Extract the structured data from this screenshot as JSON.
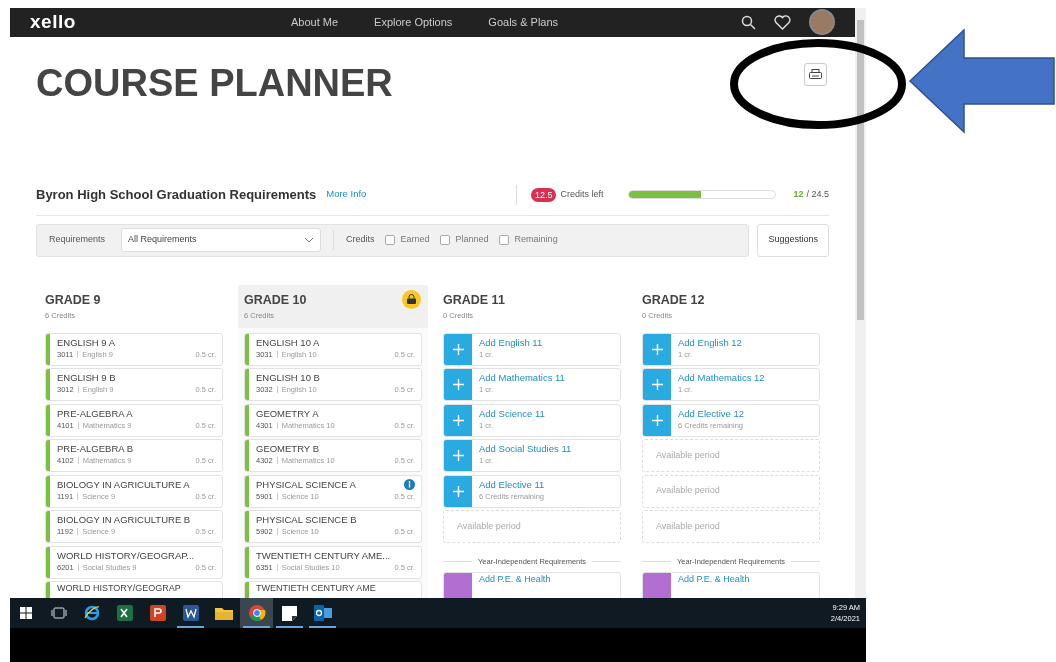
{
  "nav": {
    "logo": "xello",
    "links": [
      "About Me",
      "Explore Options",
      "Goals & Plans"
    ]
  },
  "page_title": "COURSE PLANNER",
  "requirements": {
    "title": "Byron High School Graduation Requirements",
    "more_info": "More Info",
    "credits_left": "12.5",
    "credits_left_label": "Credits left",
    "level": 0.49,
    "earned": "12",
    "total": "/ 24.5"
  },
  "filters": {
    "requirements_label": "Requirements",
    "requirements_value": "All Requirements",
    "credits_label": "Credits",
    "checkboxes": [
      {
        "label": "Earned",
        "checked": false
      },
      {
        "label": "Planned",
        "checked": false
      },
      {
        "label": "Remaining",
        "checked": false
      }
    ],
    "suggestions": "Suggestions"
  },
  "grades": [
    {
      "title": "GRADE 9",
      "credits": "6 Credits",
      "current": false,
      "locked": false,
      "items": [
        {
          "kind": "course",
          "name": "ENGLISH 9 A",
          "code": "3011",
          "subject": "English 9",
          "credits": "0.5 cr.",
          "info": false
        },
        {
          "kind": "course",
          "name": "ENGLISH 9 B",
          "code": "3012",
          "subject": "English 9",
          "credits": "0.5 cr.",
          "info": false
        },
        {
          "kind": "course",
          "name": "PRE-ALGEBRA A",
          "code": "4101",
          "subject": "Mathematics 9",
          "credits": "0.5 cr.",
          "info": false
        },
        {
          "kind": "course",
          "name": "PRE-ALGEBRA B",
          "code": "4102",
          "subject": "Mathematics 9",
          "credits": "0.5 cr.",
          "info": false
        },
        {
          "kind": "course",
          "name": "BIOLOGY IN AGRICULTURE A",
          "code": "1191",
          "subject": "Science 9",
          "credits": "0.5 cr.",
          "info": false
        },
        {
          "kind": "course",
          "name": "BIOLOGY IN AGRICULTURE B",
          "code": "1192",
          "subject": "Science 9",
          "credits": "0.5 cr.",
          "info": false
        },
        {
          "kind": "course",
          "name": "WORLD HISTORY/GEOGRAP...",
          "code": "6201",
          "subject": "Social Studies 9",
          "credits": "0.5 cr.",
          "info": false
        },
        {
          "kind": "cut",
          "name": "WORLD HISTORY/GEOGRAP"
        }
      ]
    },
    {
      "title": "GRADE 10",
      "credits": "6 Credits",
      "current": true,
      "locked": true,
      "items": [
        {
          "kind": "course",
          "name": "ENGLISH 10 A",
          "code": "3031",
          "subject": "English 10",
          "credits": "0.5 cr.",
          "info": false
        },
        {
          "kind": "course",
          "name": "ENGLISH 10 B",
          "code": "3032",
          "subject": "English 10",
          "credits": "0.5 cr.",
          "info": false
        },
        {
          "kind": "course",
          "name": "GEOMETRY A",
          "code": "4301",
          "subject": "Mathematics 10",
          "credits": "0.5 cr.",
          "info": false
        },
        {
          "kind": "course",
          "name": "GEOMETRY B",
          "code": "4302",
          "subject": "Mathematics 10",
          "credits": "0.5 cr.",
          "info": false
        },
        {
          "kind": "course",
          "name": "PHYSICAL SCIENCE A",
          "code": "5901",
          "subject": "Science 10",
          "credits": "0.5 cr.",
          "info": true
        },
        {
          "kind": "course",
          "name": "PHYSICAL SCIENCE B",
          "code": "5902",
          "subject": "Science 10",
          "credits": "0.5 cr.",
          "info": false
        },
        {
          "kind": "course",
          "name": "TWENTIETH CENTURY AME...",
          "code": "6351",
          "subject": "Social Studies 10",
          "credits": "0.5 cr.",
          "info": false
        },
        {
          "kind": "cut",
          "name": "TWENTIETH CENTURY AME"
        }
      ]
    },
    {
      "title": "GRADE 11",
      "credits": "0 Credits",
      "current": false,
      "locked": false,
      "items": [
        {
          "kind": "add",
          "name": "Add English 11",
          "detail": "1 cr."
        },
        {
          "kind": "add",
          "name": "Add Mathematics 11",
          "detail": "1 cr."
        },
        {
          "kind": "add",
          "name": "Add Science 11",
          "detail": "1 cr."
        },
        {
          "kind": "add",
          "name": "Add Social Studies 11",
          "detail": "1 cr."
        },
        {
          "kind": "add",
          "name": "Add Elective 11",
          "detail": "6 Credits remaining"
        },
        {
          "kind": "empty",
          "name": "Available period"
        },
        {
          "kind": "divider",
          "name": "Year-Independent Requirements"
        },
        {
          "kind": "cut_add",
          "name": "Add P.E. & Health"
        }
      ]
    },
    {
      "title": "GRADE 12",
      "credits": "0 Credits",
      "current": false,
      "locked": false,
      "items": [
        {
          "kind": "add",
          "name": "Add English 12",
          "detail": "1 cr."
        },
        {
          "kind": "add",
          "name": "Add Mathematics 12",
          "detail": "1 cr."
        },
        {
          "kind": "add",
          "name": "Add Elective 12",
          "detail": "6 Credits remaining"
        },
        {
          "kind": "empty",
          "name": "Available period"
        },
        {
          "kind": "empty",
          "name": "Available period"
        },
        {
          "kind": "empty",
          "name": "Available period"
        },
        {
          "kind": "divider",
          "name": "Year-Independent Requirements"
        },
        {
          "kind": "cut_add",
          "name": "Add P.E. & Health"
        }
      ]
    }
  ],
  "taskbar": {
    "apps": [
      {
        "kind": "taskview",
        "open": false,
        "selected": false
      },
      {
        "kind": "ie",
        "open": false,
        "selected": false
      },
      {
        "kind": "excel",
        "open": false,
        "selected": false
      },
      {
        "kind": "powerpoint",
        "open": false,
        "selected": false
      },
      {
        "kind": "word",
        "open": true,
        "selected": false
      },
      {
        "kind": "folder",
        "open": false,
        "selected": false
      },
      {
        "kind": "chrome",
        "open": true,
        "selected": true
      },
      {
        "kind": "sticky",
        "open": true,
        "selected": false
      },
      {
        "kind": "outlook",
        "open": true,
        "selected": false
      }
    ],
    "time": "9:29 AM",
    "date": "2/4/2021"
  }
}
